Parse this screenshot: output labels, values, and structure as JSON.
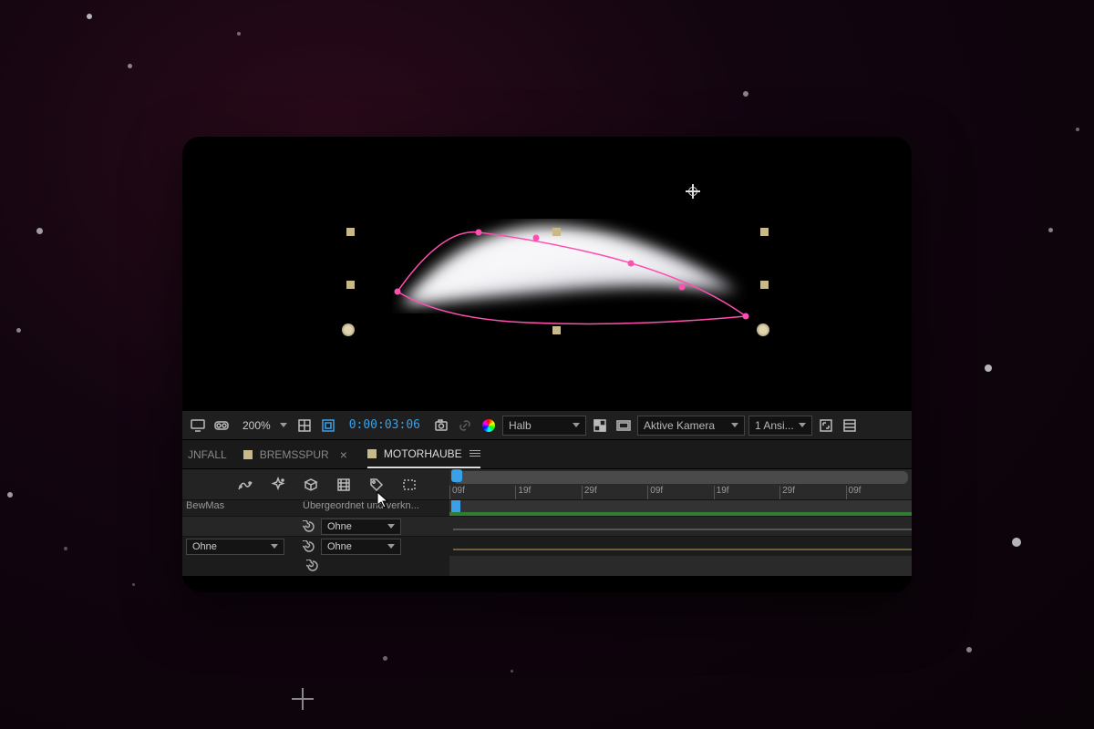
{
  "toolbar": {
    "zoom": "200%",
    "timecode": "0:00:03:06",
    "resolution": "Halb",
    "camera": "Aktive Kamera",
    "views": "1 Ansi..."
  },
  "tabs": {
    "left_partial": "JNFALL",
    "middle": "BREMSSPUR",
    "active": "MOTORHAUBE"
  },
  "ruler": [
    "09f",
    "19f",
    "29f",
    "09f",
    "19f",
    "29f",
    "09f"
  ],
  "columns": {
    "c1": "BewMas",
    "c2": "Übergeordnet und verkn..."
  },
  "rows": {
    "none": "Ohne"
  },
  "icons": {
    "monitor": "monitor-icon",
    "vr": "vr-goggles-icon",
    "grid": "grid-icon",
    "mask": "mask-bounds-icon",
    "camera": "camera-snapshot-icon",
    "link": "link-icon",
    "colorwheel": "color-wheel-icon",
    "transparency": "transparency-grid-icon",
    "safezone": "safe-zones-icon",
    "fit": "fit-icon",
    "channels": "channels-icon",
    "graph": "graph-editor-icon",
    "sparkle": "new-layer-icon",
    "cube": "3d-icon",
    "filmstrip": "render-queue-icon",
    "tag": "tag-icon",
    "box": "region-icon"
  }
}
